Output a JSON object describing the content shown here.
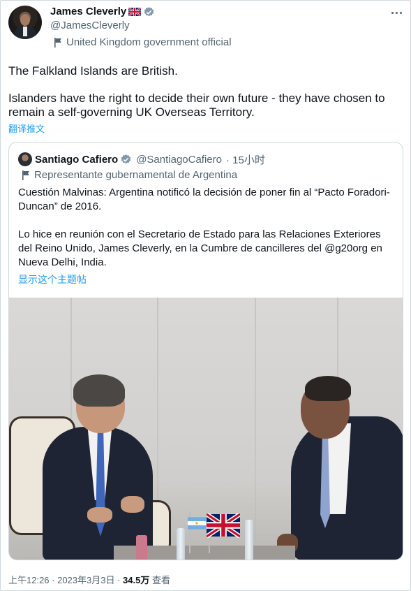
{
  "author": {
    "name": "James Cleverly",
    "handle": "@JamesCleverly",
    "label": "United Kingdom government official"
  },
  "tweet": {
    "line1": "The Falkland Islands are British.",
    "line2": "Islanders have the right to decide their own future - they have chosen to remain a self-governing UK Overseas Territory.",
    "translate": "翻译推文"
  },
  "quote": {
    "name": "Santiago Cafiero",
    "handle": "@SantiagoCafiero",
    "time": "· 15小时",
    "label": "Representante gubernamental de Argentina",
    "para1": "Cuestión Malvinas: Argentina notificó la decisión de poner fin al “Pacto Foradori-Duncan” de 2016.",
    "para2": "Lo hice en reunión con el Secretario de Estado para las Relaciones Exteriores del Reino Unido, James Cleverly, en la Cumbre de cancilleres del @g20org en Nueva Delhi, India.",
    "show_thread": "显示这个主题帖"
  },
  "footer": {
    "time_date": "上午12:26 · 2023年3月3日 · ",
    "views_count": "34.5万",
    "views_label": " 查看"
  },
  "colors": {
    "link": "#1d9bf0",
    "secondary": "#536471",
    "verified": "#829aab"
  }
}
